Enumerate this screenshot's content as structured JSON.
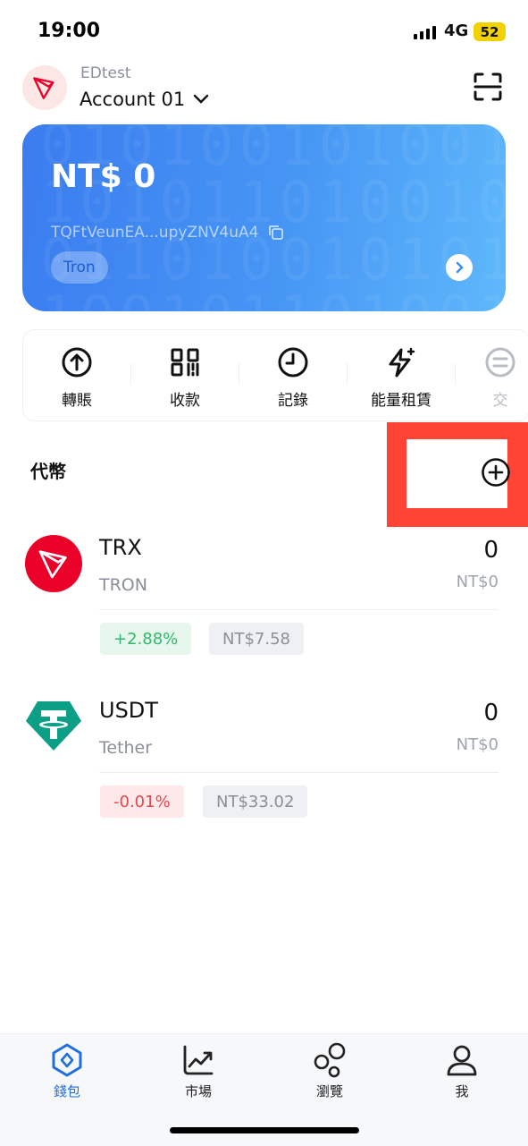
{
  "status": {
    "time": "19:00",
    "network": "4G",
    "battery": "52"
  },
  "header": {
    "wallet_name": "EDtest",
    "account": "Account 01"
  },
  "card": {
    "balance": "NT$ 0",
    "address": "TQFtVeunEA...upyZNV4uA4",
    "chain": "Tron"
  },
  "actions": [
    "轉賬",
    "收款",
    "記錄",
    "能量租賃",
    "交"
  ],
  "tokens_section": {
    "title": "代幣"
  },
  "tokens": [
    {
      "symbol": "TRX",
      "name": "TRON",
      "amount": "0",
      "fiat": "NT$0",
      "change": "+2.88%",
      "price": "NT$7.58",
      "trend": "up"
    },
    {
      "symbol": "USDT",
      "name": "Tether",
      "amount": "0",
      "fiat": "NT$0",
      "change": "-0.01%",
      "price": "NT$33.02",
      "trend": "down"
    }
  ],
  "nav": [
    "錢包",
    "市場",
    "瀏覽",
    "我"
  ],
  "colors": {
    "accent": "#1e6fe0",
    "card_start": "#3b7cf0",
    "card_end": "#5fb8fb",
    "tron_red": "#eb0029",
    "tether_green": "#0d9f86",
    "highlight_box": "#ff4436"
  }
}
